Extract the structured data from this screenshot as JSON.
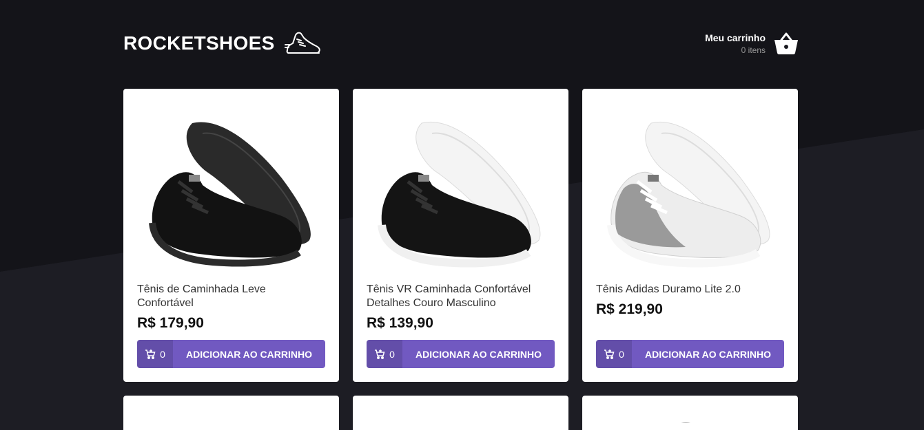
{
  "header": {
    "logo_text": "ROCKETSHOES",
    "logo_icon": "sneaker-icon",
    "cart_title": "Meu carrinho",
    "cart_count": "0 itens",
    "cart_icon": "basket-icon"
  },
  "colors": {
    "background": "#191920",
    "accent": "#7159c1",
    "card": "#ffffff"
  },
  "products": [
    {
      "name": "Tênis de Caminhada Leve Confortável",
      "price": "R$ 179,90",
      "cart_qty": "0",
      "button_label": "ADICIONAR AO CARRINHO",
      "image": "black-sneaker"
    },
    {
      "name": "Tênis VR Caminhada Confortável Detalhes Couro Masculino",
      "price": "R$ 139,90",
      "cart_qty": "0",
      "button_label": "ADICIONAR AO CARRINHO",
      "image": "black-white-sole-sneaker"
    },
    {
      "name": "Tênis Adidas Duramo Lite 2.0",
      "price": "R$ 219,90",
      "cart_qty": "0",
      "button_label": "ADICIONAR AO CARRINHO",
      "image": "white-grey-sneaker"
    }
  ]
}
